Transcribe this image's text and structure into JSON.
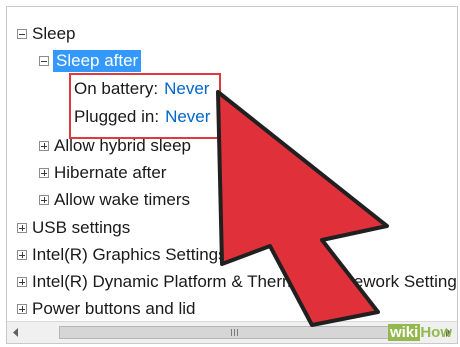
{
  "tree": {
    "sleep": "Sleep",
    "sleep_after": "Sleep after",
    "on_battery_label": "On battery:",
    "on_battery_value": "Never",
    "plugged_in_label": "Plugged in:",
    "plugged_in_value": "Never",
    "hybrid_sleep": "Allow hybrid sleep",
    "hibernate_after": "Hibernate after",
    "wake_timers": "Allow wake timers",
    "usb_settings": "USB settings",
    "intel_graphics": "Intel(R) Graphics Settings",
    "intel_dptf": "Intel(R) Dynamic Platform & Thermal Framework Settings",
    "power_buttons_partial": "Power buttons and lid"
  },
  "colors": {
    "selection": "#3399ff",
    "value_link": "#0066cc",
    "highlight_box": "#e03a3e",
    "pointer_arrow": "#e0313b"
  },
  "icons": {
    "expanded": "minus-box-icon",
    "collapsed": "plus-box-icon",
    "annotation": "red-pointer-arrow"
  },
  "watermark": {
    "wiki": "wiki",
    "how": "How"
  }
}
